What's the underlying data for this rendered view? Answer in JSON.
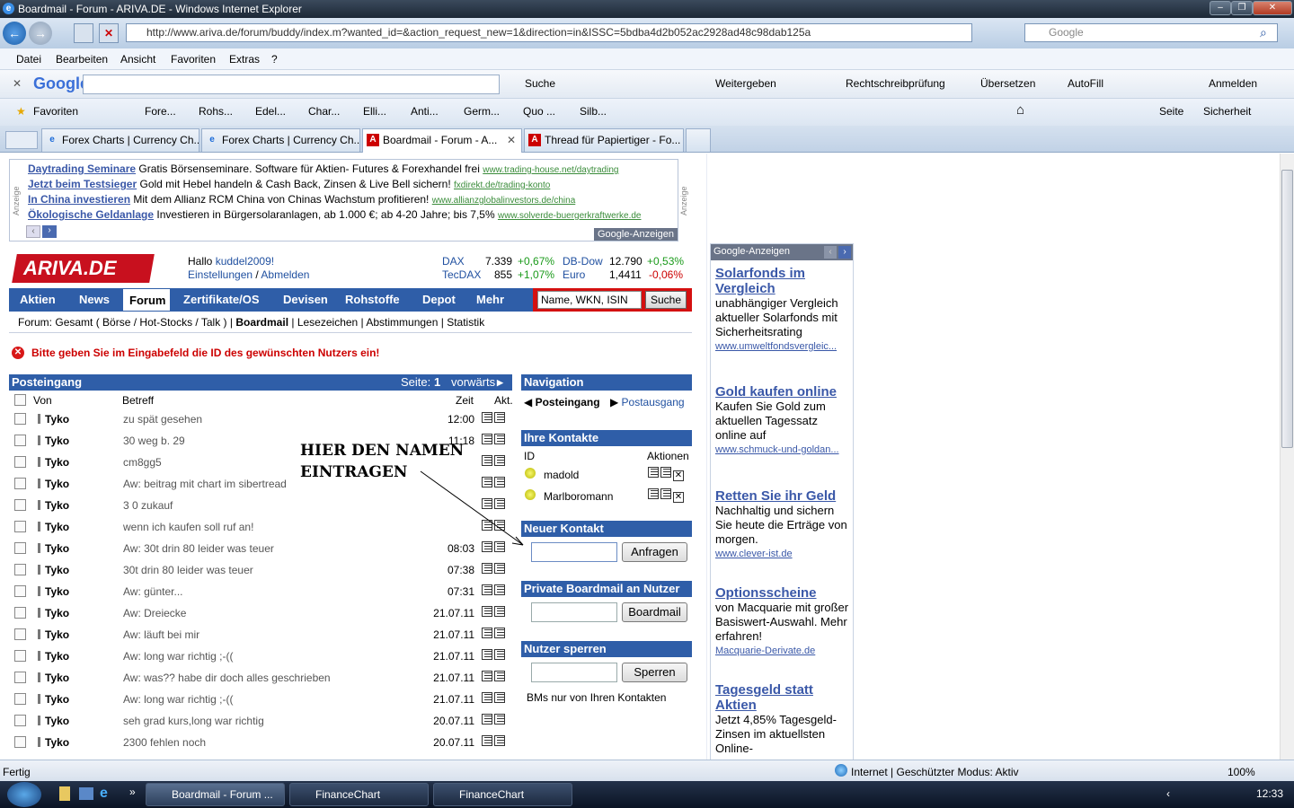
{
  "window": {
    "title": "Boardmail - Forum - ARIVA.DE - Windows Internet Explorer"
  },
  "browser": {
    "url": "http://www.ariva.de/forum/buddy/index.m?wanted_id=&action_request_new=1&direction=in&ISSC=5bdba4d2b052ac2928ad48c98dab125a",
    "search_placeholder": "Google",
    "menu": [
      "Datei",
      "Bearbeiten",
      "Ansicht",
      "Favoriten",
      "Extras",
      "?"
    ],
    "google_toolbar": {
      "suche": "Suche",
      "weitergeben": "Weitergeben",
      "rechtschreib": "Rechtschreibprüfung",
      "uebersetzen": "Übersetzen",
      "autofill": "AutoFill",
      "anmelden": "Anmelden"
    },
    "favorites": {
      "label": "Favoriten",
      "items": [
        "Fore...",
        "Rohs...",
        "Edel...",
        "Char...",
        "Elli...",
        "Anti...",
        "Germ...",
        "Quo ...",
        "Silb..."
      ],
      "seite": "Seite",
      "sicherheit": "Sicherheit"
    },
    "tabs": [
      "Forex Charts | Currency Ch...",
      "Forex Charts | Currency Ch...",
      "Boardmail - Forum - A...",
      "Thread für Papiertiger - Fo..."
    ]
  },
  "ads": {
    "label": "Anzeige",
    "lines": [
      {
        "title": "Daytrading Seminare",
        "text": "Gratis Börsenseminare. Software für Aktien- Futures & Forexhandel frei",
        "url": "www.trading-house.net/daytrading"
      },
      {
        "title": "Jetzt beim Testsieger",
        "text": "Gold mit Hebel handeln & Cash Back, Zinsen & Live Bell sichern!",
        "url": "fxdirekt.de/trading-konto"
      },
      {
        "title": "In China investieren",
        "text": "Mit dem Allianz RCM China von Chinas Wachstum profitieren!",
        "url": "www.allianzglobalinvestors.de/china"
      },
      {
        "title": "Ökologische Geldanlage",
        "text": "Investieren in Bürgersolaranlagen, ab 1.000 €; ab 4-20 Jahre; bis 7,5%",
        "url": "www.solverde-buergerkraftwerke.de"
      }
    ],
    "google_label": "Google-Anzeigen"
  },
  "header": {
    "logo": "ARIVA.DE",
    "hallo": "Hallo",
    "user": "kuddel2009!",
    "einstellungen": "Einstellungen",
    "abmelden": "Abmelden",
    "quotes": [
      {
        "name": "DAX",
        "value": "7.339",
        "change": "+0,67%"
      },
      {
        "name": "DB-Dow",
        "value": "12.790",
        "change": "+0,53%"
      },
      {
        "name": "TecDAX",
        "value": "855",
        "change": "+1,07%"
      },
      {
        "name": "Euro",
        "value": "1,4411",
        "change": "-0,06%"
      }
    ]
  },
  "nav": {
    "items": [
      "Aktien",
      "News",
      "Forum",
      "Zertifikate/OS",
      "Devisen",
      "Rohstoffe",
      "Depot",
      "Mehr"
    ],
    "search_value": "Name, WKN, ISIN",
    "search_btn": "Suche"
  },
  "subnav": {
    "prefix": "Forum:",
    "gesamt": "Gesamt (",
    "boerse": "Börse / Hot-Stocks / Talk )",
    "boardmail": "Boardmail",
    "lesezeichen": "Lesezeichen",
    "abstimmungen": "Abstimmungen",
    "statistik": "Statistik"
  },
  "error": "Bitte geben Sie im Eingabefeld die ID des gewünschten Nutzers ein!",
  "inbox": {
    "title": "Posteingang",
    "seite": "Seite:",
    "page": "1",
    "vorwaerts": "vorwärts",
    "cols": {
      "von": "Von",
      "betreff": "Betreff",
      "zeit": "Zeit",
      "akt": "Akt."
    },
    "rows": [
      {
        "from": "Tyko",
        "subject": "zu spät gesehen",
        "time": "12:00"
      },
      {
        "from": "Tyko",
        "subject": "30 weg b. 29",
        "time": "11:18"
      },
      {
        "from": "Tyko",
        "subject": "cm8gg5",
        "time": ""
      },
      {
        "from": "Tyko",
        "subject": "Aw: beitrag mit chart im sibertread",
        "time": ""
      },
      {
        "from": "Tyko",
        "subject": "3 0 zukauf",
        "time": ""
      },
      {
        "from": "Tyko",
        "subject": "wenn ich kaufen soll ruf an!",
        "time": ""
      },
      {
        "from": "Tyko",
        "subject": "Aw: 30t drin 80 leider was teuer",
        "time": "08:03"
      },
      {
        "from": "Tyko",
        "subject": "30t drin 80 leider was teuer",
        "time": "07:38"
      },
      {
        "from": "Tyko",
        "subject": "Aw: günter...",
        "time": "07:31"
      },
      {
        "from": "Tyko",
        "subject": "Aw: Dreiecke",
        "time": "21.07.11"
      },
      {
        "from": "Tyko",
        "subject": "Aw: läuft bei mir",
        "time": "21.07.11"
      },
      {
        "from": "Tyko",
        "subject": "Aw: long war richtig ;-((",
        "time": "21.07.11"
      },
      {
        "from": "Tyko",
        "subject": "Aw: was?? habe dir doch alles geschrieben",
        "time": "21.07.11"
      },
      {
        "from": "Tyko",
        "subject": "Aw: long war richtig ;-((",
        "time": "21.07.11"
      },
      {
        "from": "Tyko",
        "subject": "seh grad kurs,long war richtig",
        "time": "20.07.11"
      },
      {
        "from": "Tyko",
        "subject": "2300 fehlen noch",
        "time": "20.07.11"
      }
    ]
  },
  "annotation": {
    "line1": "HIER DEN NAMEN",
    "line2": "EINTRAGEN"
  },
  "sidebar": {
    "navigation": "Navigation",
    "posteingang": "Posteingang",
    "postausgang": "Postausgang",
    "kontakte": "Ihre Kontakte",
    "id": "ID",
    "aktionen": "Aktionen",
    "contacts": [
      "madold",
      "Marlboromann"
    ],
    "neuer": "Neuer Kontakt",
    "anfragen": "Anfragen",
    "private": "Private Boardmail an Nutzer",
    "boardmail_btn": "Boardmail",
    "sperren_title": "Nutzer sperren",
    "sperren_btn": "Sperren",
    "bms_link": "BMs nur von Ihren Kontakten"
  },
  "right_ads": {
    "label": "Google-Anzeigen",
    "items": [
      {
        "title": "Solarfonds im Vergleich",
        "text": "unabhängiger Vergleich aktueller Solarfonds mit Sicherheitsrating",
        "url": "www.umweltfondsvergleic..."
      },
      {
        "title": "Gold kaufen online",
        "text": "Kaufen Sie Gold zum aktuellen Tagessatz online auf",
        "url": "www.schmuck-und-goldan..."
      },
      {
        "title": "Retten Sie ihr Geld",
        "text": "Nachhaltig und sichern Sie heute die Erträge von morgen.",
        "url": "www.clever-ist.de"
      },
      {
        "title": "Optionsscheine",
        "text": "von Macquarie mit großer Basiswert-Auswahl. Mehr erfahren!",
        "url": "Macquarie-Derivate.de"
      },
      {
        "title": "Tagesgeld statt Aktien",
        "text": "Jetzt 4,85% Tagesgeld-Zinsen im aktuellsten Online-",
        "url": ""
      }
    ]
  },
  "status": {
    "left": "Fertig",
    "zone": "Internet | Geschützter Modus: Aktiv",
    "zoom": "100%"
  },
  "taskbar": {
    "items": [
      "Boardmail - Forum ...",
      "FinanceChart",
      "FinanceChart"
    ],
    "clock": "12:33"
  }
}
